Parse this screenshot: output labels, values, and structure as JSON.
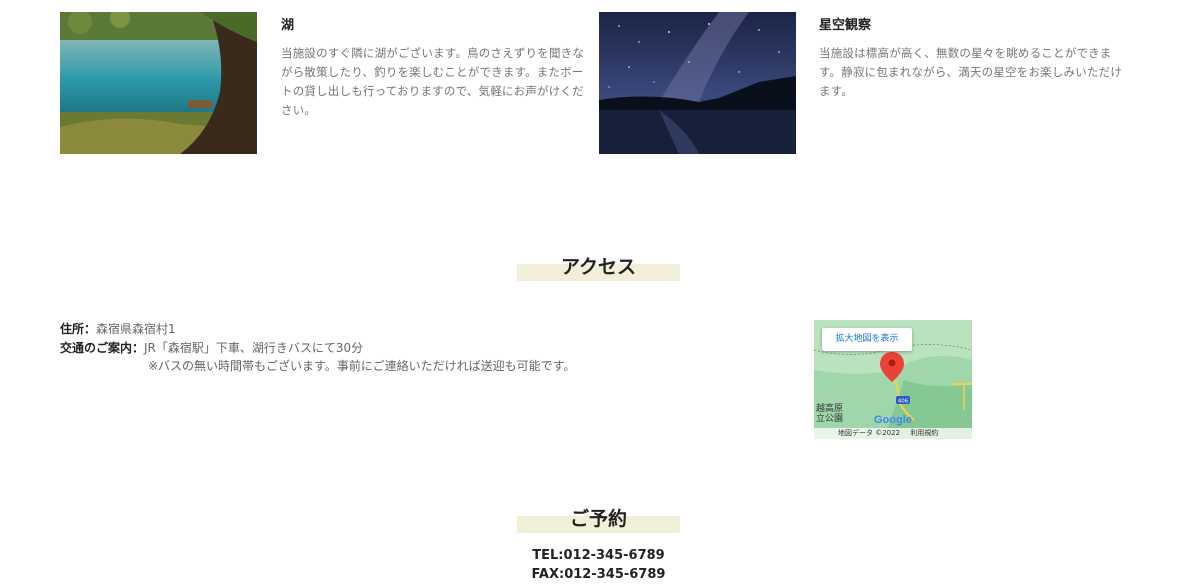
{
  "features": [
    {
      "title": "湖",
      "text": "当施設のすぐ隣に湖がございます。鳥のさえずりを聞きながら散策したり、釣りを楽しむことができます。またボートの貸し出しも行っておりますので、気軽にお声がけください。"
    },
    {
      "title": "星空観察",
      "text": "当施設は標高が高く、無数の星々を眺めることができます。静寂に包まれながら、満天の星空をお楽しみいただけます。"
    }
  ],
  "access": {
    "heading": "アクセス",
    "address_label": "住所：",
    "address_value": "森宿県森宿村1",
    "transport_label": "交通のご案内：",
    "transport_value": "JR「森宿駅」下車、湖行きバスにて30分",
    "transport_note": "※バスの無い時間帯もございます。事前にご連絡いただければ送迎も可能です。"
  },
  "map": {
    "enlarge_label": "拡大地図を表示",
    "road_number": "406",
    "place_label": "越高原\n立公園",
    "logo": "Google",
    "footer_data": "地図データ ©2022",
    "footer_terms": "利用規約"
  },
  "reservation": {
    "heading": "ご予約",
    "tel": "TEL:012-345-6789",
    "fax": "FAX:012-345-6789"
  },
  "colors": {
    "heading_underline": "#f1efd8",
    "map_green": "#8fd19e",
    "pin_red": "#ea4335"
  }
}
